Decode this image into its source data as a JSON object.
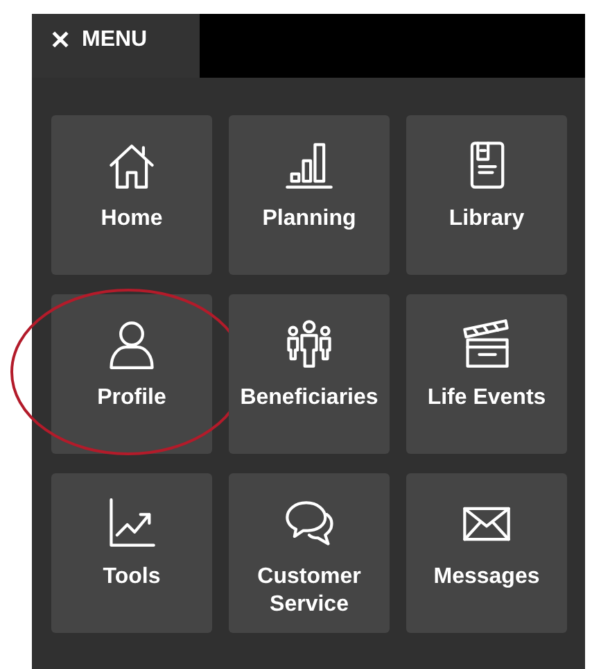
{
  "header": {
    "close_icon_text": "✕",
    "title": "MENU"
  },
  "tiles": [
    {
      "label": "Home",
      "highlighted": false
    },
    {
      "label": "Planning",
      "highlighted": false
    },
    {
      "label": "Library",
      "highlighted": false
    },
    {
      "label": "Profile",
      "highlighted": true
    },
    {
      "label": "Beneficiaries",
      "highlighted": false
    },
    {
      "label": "Life Events",
      "highlighted": false
    },
    {
      "label": "Tools",
      "highlighted": false
    },
    {
      "label": "Customer Service",
      "highlighted": false
    },
    {
      "label": "Messages",
      "highlighted": false
    }
  ]
}
